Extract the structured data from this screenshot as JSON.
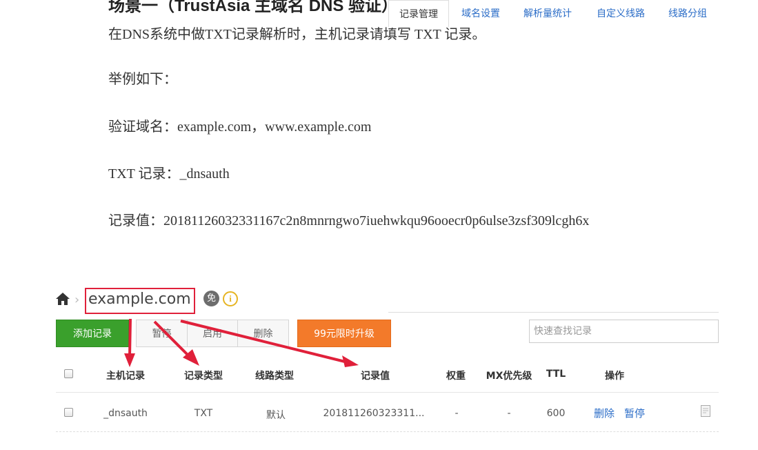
{
  "doc": {
    "title": "场景一（TrustAsia 主域名 DNS 验证）",
    "intro": "在DNS系统中做TXT记录解析时，主机记录请填写 TXT 记录。",
    "example_label": "举例如下：",
    "domain_line": "验证域名：example.com，www.example.com",
    "txt_line": "TXT 记录：_dnsauth",
    "value_line": "记录值：20181126032331167c2n8mnrngwo7iuehwkqu96ooecr0p6ulse3zsf309lcgh6x"
  },
  "panel": {
    "domain": "example.com",
    "free_badge": "免",
    "info_icon": "i",
    "tabs": [
      "记录管理",
      "域名设置",
      "解析量统计",
      "自定义线路",
      "线路分组"
    ],
    "active_tab": 0,
    "buttons": {
      "add": "添加记录",
      "pause": "暂停",
      "enable": "启用",
      "delete": "删除",
      "upgrade": "99元限时升级"
    },
    "search_placeholder": "快速查找记录",
    "columns": [
      "主机记录",
      "记录类型",
      "线路类型",
      "记录值",
      "权重",
      "MX优先级",
      "TTL",
      "操作"
    ],
    "rows": [
      {
        "host": "_dnsauth",
        "type": "TXT",
        "line": "默认",
        "value": "201811260323311...",
        "weight": "-",
        "mx": "-",
        "ttl": "600",
        "actions": [
          "删除",
          "暂停"
        ]
      }
    ],
    "annotation_color": "#e0203a"
  }
}
